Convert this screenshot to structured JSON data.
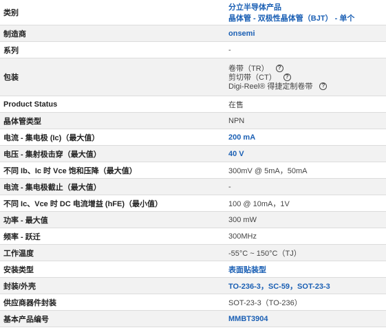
{
  "rows": [
    {
      "label": "类别",
      "value": [
        "分立半导体产品",
        "晶体管 - 双极性晶体管（BJT） - 单个"
      ],
      "link": true
    },
    {
      "label": "制造商",
      "value": [
        "onsemi"
      ],
      "link": true
    },
    {
      "label": "系列",
      "value": [
        "-"
      ],
      "link": false
    },
    {
      "label": "包装",
      "value": [
        "卷带（TR）",
        "剪切带（CT）",
        "Digi-Reel® 得捷定制卷带"
      ],
      "link": false,
      "help": true
    },
    {
      "label": "Product Status",
      "value": [
        "在售"
      ],
      "link": false
    },
    {
      "label": "晶体管类型",
      "value": [
        "NPN"
      ],
      "link": false
    },
    {
      "label": "电流 - 集电极 (Ic)（最大值）",
      "value": [
        "200 mA"
      ],
      "link": true
    },
    {
      "label": "电压 - 集射极击穿（最大值）",
      "value": [
        "40 V"
      ],
      "link": true
    },
    {
      "label": "不同 Ib、Ic 时 Vce 饱和压降（最大值）",
      "value": [
        "300mV @ 5mA，50mA"
      ],
      "link": false
    },
    {
      "label": "电流 - 集电极截止（最大值）",
      "value": [
        "-"
      ],
      "link": false
    },
    {
      "label": "不同 Ic、Vce 时 DC 电流增益 (hFE)（最小值）",
      "value": [
        "100 @ 10mA，1V"
      ],
      "link": false
    },
    {
      "label": "功率 - 最大值",
      "value": [
        "300 mW"
      ],
      "link": false
    },
    {
      "label": "频率 - 跃迁",
      "value": [
        "300MHz"
      ],
      "link": false
    },
    {
      "label": "工作温度",
      "value": [
        "-55°C ~ 150°C（TJ）"
      ],
      "link": false
    },
    {
      "label": "安装类型",
      "value": [
        "表面贴装型"
      ],
      "link": true
    },
    {
      "label": "封装/外壳",
      "value": [
        "TO-236-3，SC-59，SOT-23-3"
      ],
      "link": true
    },
    {
      "label": "供应商器件封装",
      "value": [
        "SOT-23-3（TO-236）"
      ],
      "link": false
    },
    {
      "label": "基本产品编号",
      "value": [
        "MMBT3904"
      ],
      "link": true
    }
  ],
  "help_icon": "question-circle-icon",
  "colors": {
    "link": "#1a5fb4",
    "alt_row": "#f2f2f2",
    "border": "#dcdcdc"
  }
}
